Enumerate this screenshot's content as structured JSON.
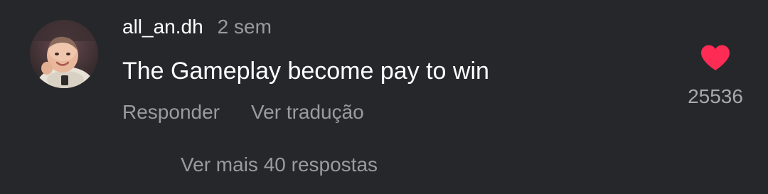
{
  "comment": {
    "avatar_icon": "user-avatar-photo",
    "username": "all_an.dh",
    "timestamp": "2 sem",
    "text": "The Gameplay become pay to win",
    "actions": {
      "reply_label": "Responder",
      "translate_label": "Ver tradução"
    },
    "like": {
      "icon": "heart-icon",
      "liked": true,
      "color": "#fe2c55",
      "count": "25536"
    },
    "more_replies_label": "Ver mais 40 respostas"
  },
  "colors": {
    "background": "#26272b",
    "primary_text": "#ffffff",
    "secondary_text": "#9a9ba0",
    "like_active": "#fe2c55"
  }
}
